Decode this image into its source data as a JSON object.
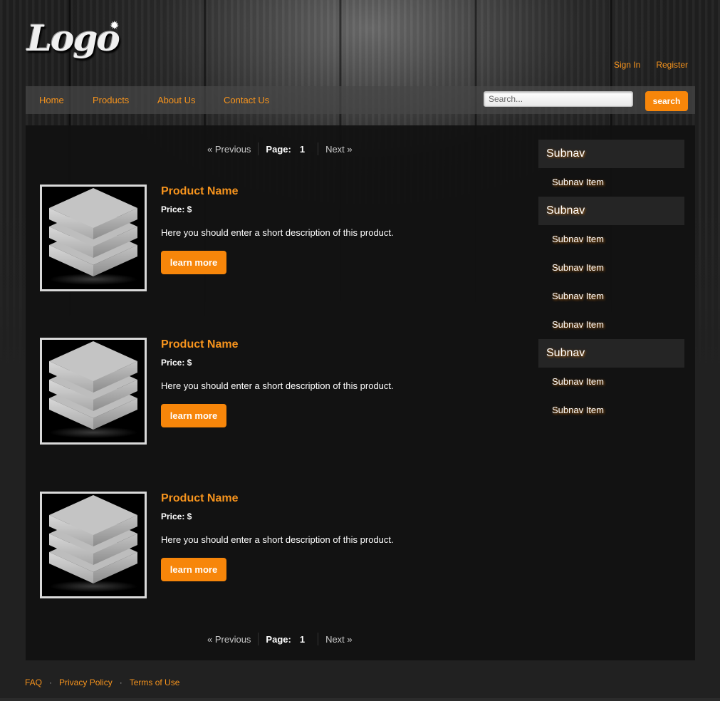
{
  "header": {
    "logo_text": "Logo",
    "sign_in": "Sign In",
    "register": "Register"
  },
  "nav": {
    "items": [
      {
        "label": "Home"
      },
      {
        "label": "Products"
      },
      {
        "label": "About Us"
      },
      {
        "label": "Contact Us"
      }
    ],
    "search_placeholder": "Search...",
    "search_button": "search"
  },
  "pagination": {
    "previous": "« Previous",
    "page_label": "Page:",
    "page_number": "1",
    "next": "Next »"
  },
  "products": [
    {
      "name": "Product Name",
      "price": "Price: $",
      "description": "Here you should enter a short description of this product.",
      "button": "learn more"
    },
    {
      "name": "Product Name",
      "price": "Price: $",
      "description": "Here you should enter a short description of this product.",
      "button": "learn more"
    },
    {
      "name": "Product Name",
      "price": "Price: $",
      "description": "Here you should enter a short description of this product.",
      "button": "learn more"
    }
  ],
  "sidebar": {
    "groups": [
      {
        "title": "Subnav",
        "items": [
          "Subnav Item"
        ]
      },
      {
        "title": "Subnav",
        "items": [
          "Subnav Item",
          "Subnav Item",
          "Subnav Item",
          "Subnav Item"
        ]
      },
      {
        "title": "Subnav",
        "items": [
          "Subnav Item",
          "Subnav Item"
        ]
      }
    ]
  },
  "footer": {
    "links": [
      "FAQ",
      "Privacy Policy",
      "Terms of Use"
    ]
  },
  "colors": {
    "accent": "#f7941d",
    "button": "#f7860a",
    "background": "#212121",
    "content_bg": "#111111"
  }
}
